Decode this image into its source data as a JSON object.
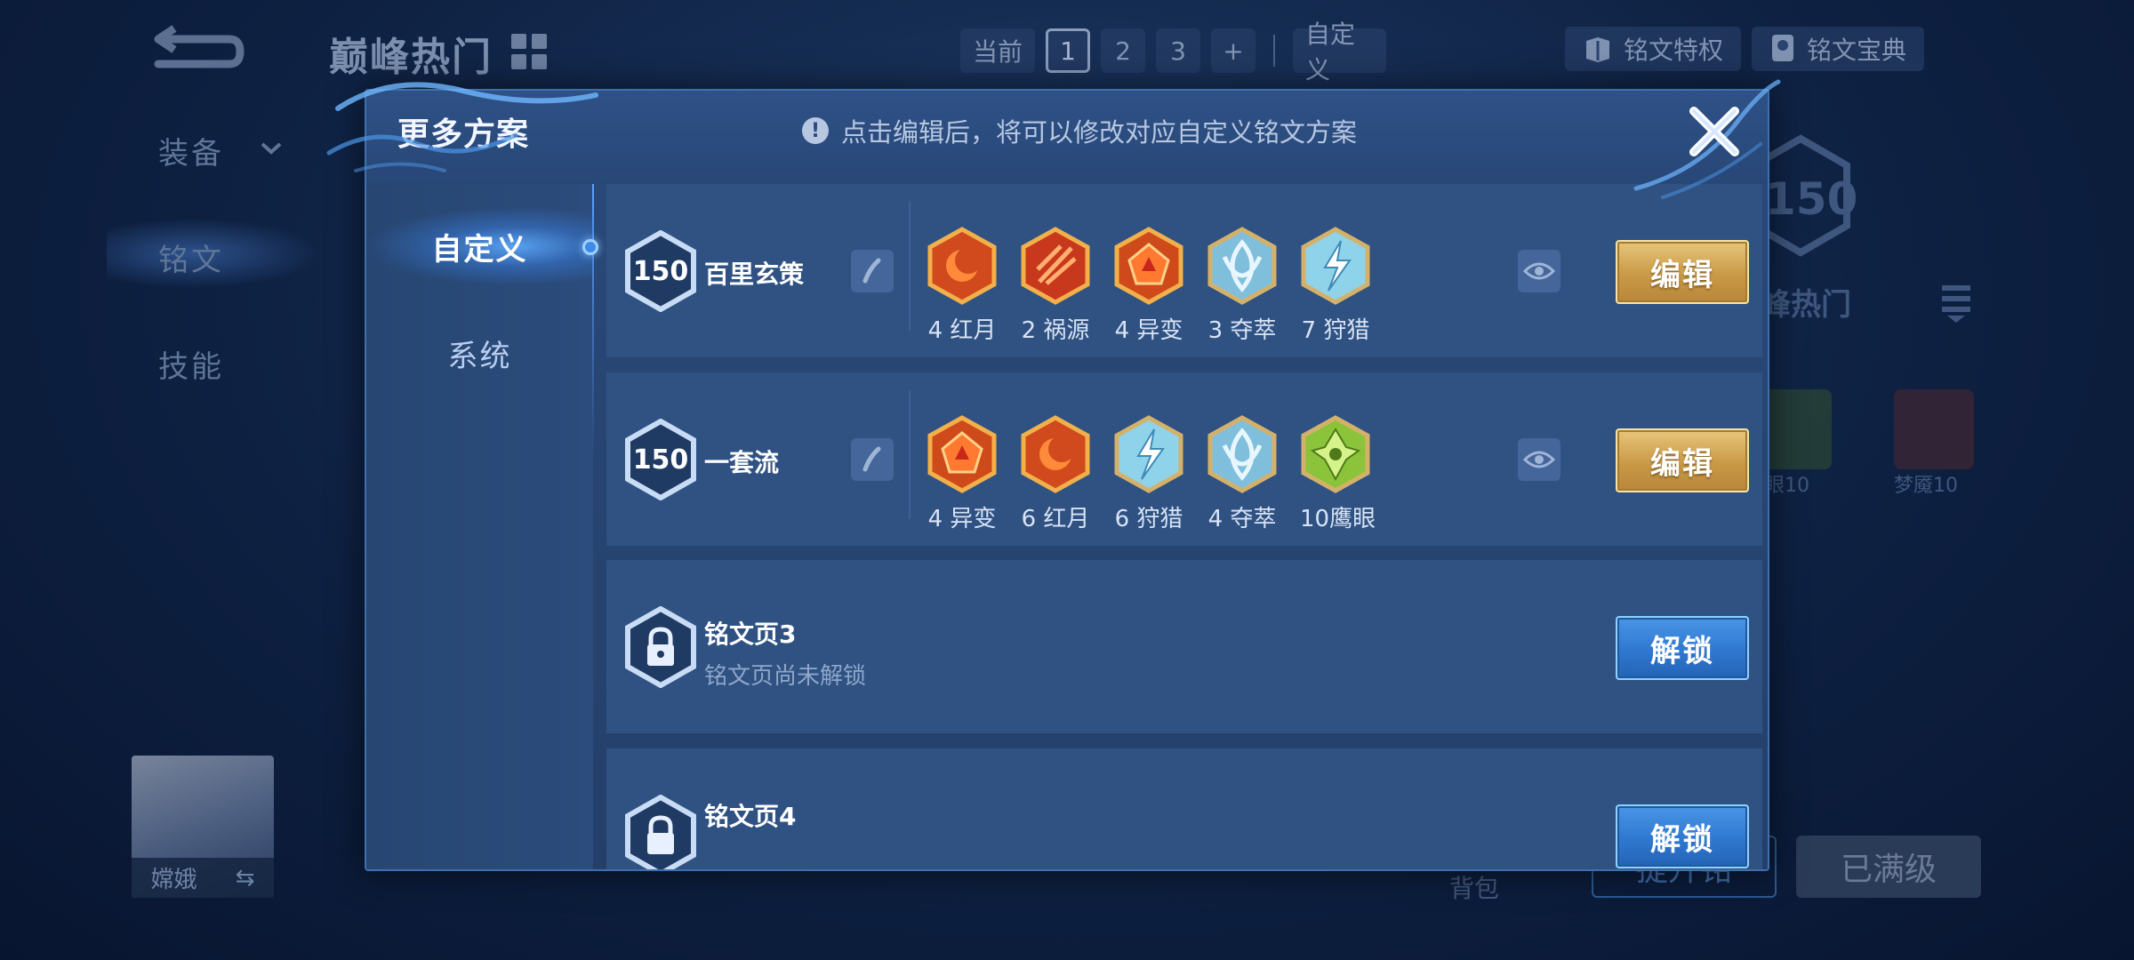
{
  "background": {
    "title": "巅峰热门",
    "topbar": {
      "current_label": "当前",
      "pages": [
        "1",
        "2",
        "3"
      ],
      "add_label": "+",
      "custom_label": "自定义",
      "privilege_label": "铭文特权",
      "codex_label": "铭文宝典"
    },
    "nav": {
      "equipment": "装备",
      "rune": "铭文",
      "skill": "技能"
    },
    "hero_name": "嫦娥",
    "swap_icon": "⇆",
    "right_panel": {
      "level": "150",
      "name": "峰热门",
      "rune_labels": [
        "眼10",
        "梦魇10"
      ]
    },
    "bag_label": "背包",
    "upgrade_label": "提升铭",
    "maxed_label": "已满级"
  },
  "modal": {
    "title": "更多方案",
    "hint": "点击编辑后，将可以修改对应自定义铭文方案",
    "tabs": [
      {
        "label": "自定义",
        "active": true
      },
      {
        "label": "系统",
        "active": false
      }
    ],
    "schemes": [
      {
        "level": "150",
        "name": "百里玄策",
        "runes": [
          {
            "label": "4 红月",
            "icon": "red-moon-icon"
          },
          {
            "label": "2 祸源",
            "icon": "calamity-icon"
          },
          {
            "label": "4 异变",
            "icon": "mutation-icon"
          },
          {
            "label": "3 夺萃",
            "icon": "plunder-icon"
          },
          {
            "label": "7 狩猎",
            "icon": "hunt-icon"
          }
        ],
        "button": "编辑"
      },
      {
        "level": "150",
        "name": "一套流",
        "runes": [
          {
            "label": "4 异变",
            "icon": "mutation-icon"
          },
          {
            "label": "6 红月",
            "icon": "red-moon-icon"
          },
          {
            "label": "6 狩猎",
            "icon": "hunt-icon"
          },
          {
            "label": "4 夺萃",
            "icon": "plunder-icon"
          },
          {
            "label": "10鹰眼",
            "icon": "hawk-eye-icon"
          }
        ],
        "button": "编辑"
      },
      {
        "name": "铭文页3",
        "subtitle": "铭文页尚未解锁",
        "button": "解锁"
      },
      {
        "name": "铭文页4",
        "button": "解锁"
      }
    ]
  },
  "colors": {
    "gold_button": "#c99a47",
    "blue_button": "#2f78d0",
    "modal_bg": "#2a4a7a",
    "row_bg": "#2f5283",
    "red_rune": "#d14a1e",
    "blue_rune": "#8fd3ea",
    "green_rune": "#8bc43a"
  }
}
